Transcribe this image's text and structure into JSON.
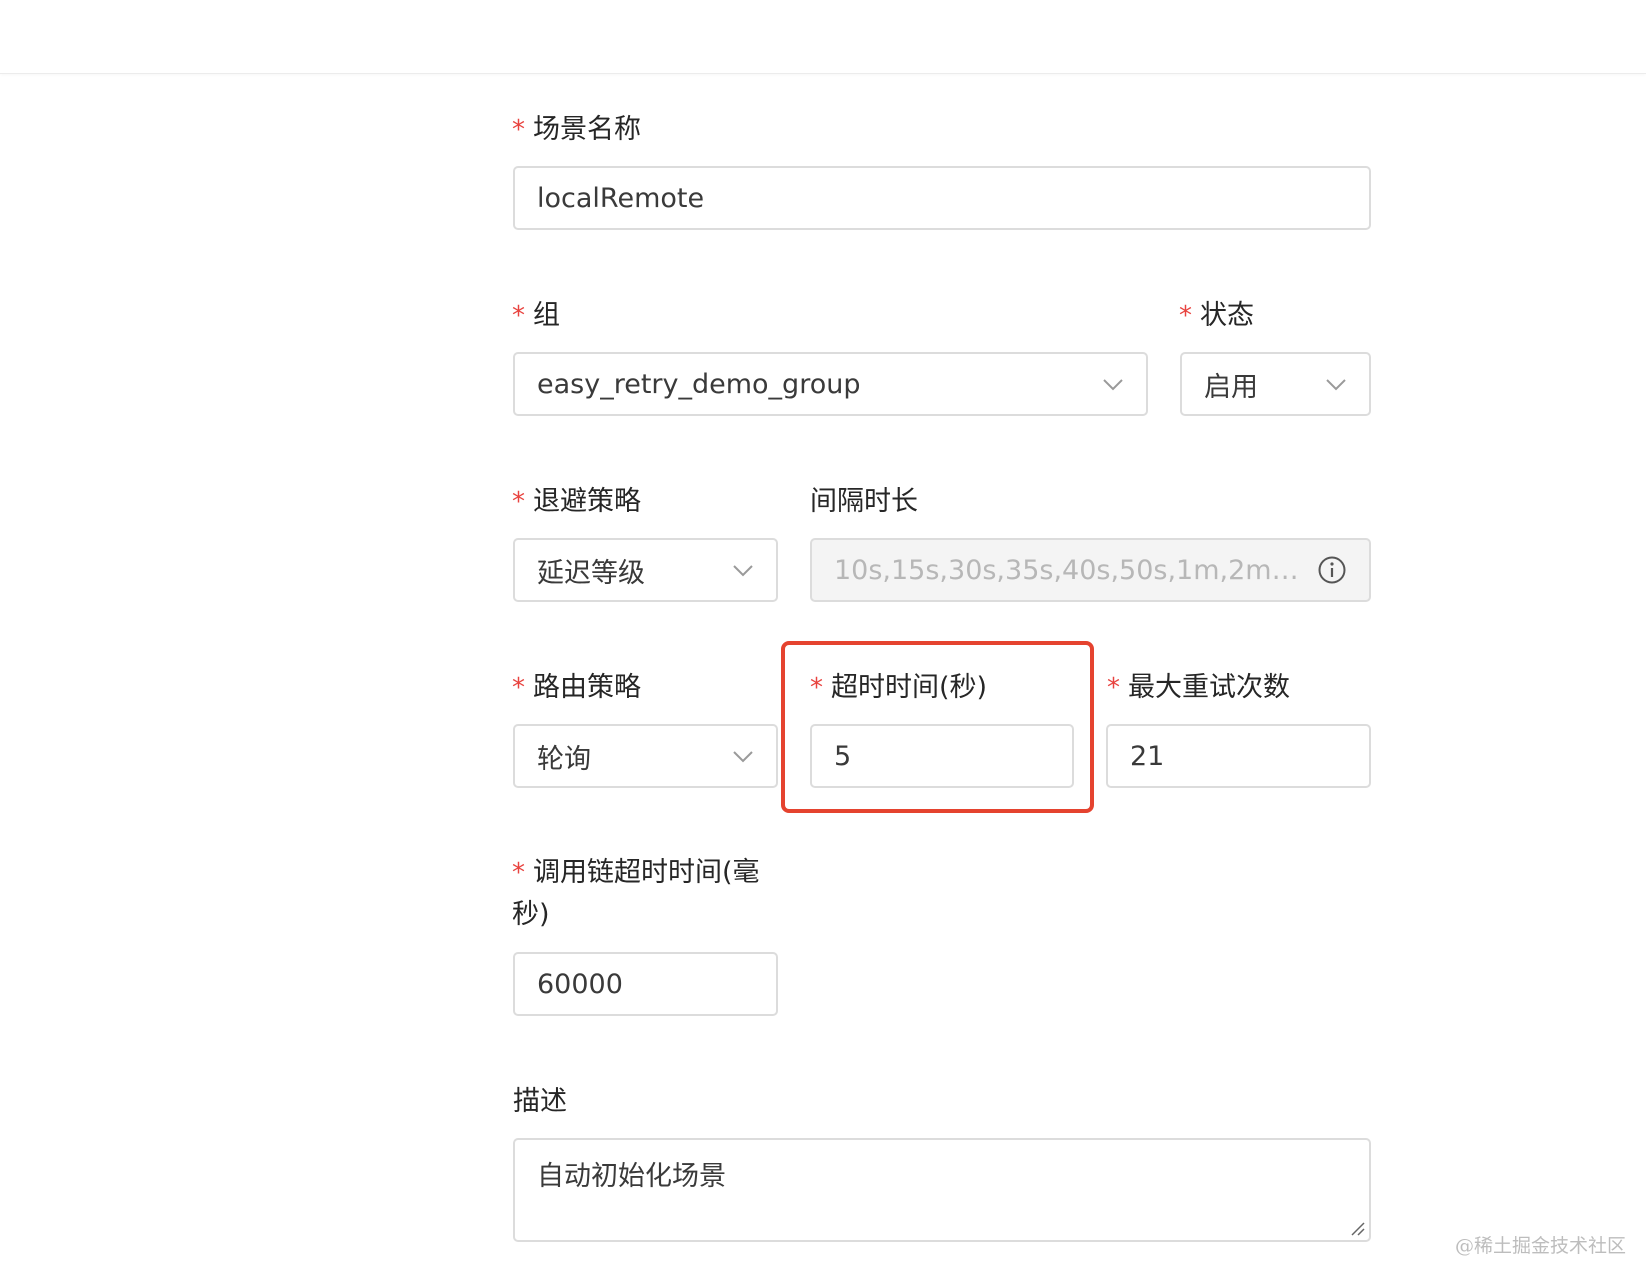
{
  "form": {
    "scene_name": {
      "label": "场景名称",
      "value": "localRemote"
    },
    "group": {
      "label": "组",
      "value": "easy_retry_demo_group"
    },
    "status": {
      "label": "状态",
      "value": "启用"
    },
    "backoff_strategy": {
      "label": "退避策略",
      "value": "延迟等级"
    },
    "interval": {
      "label": "间隔时长",
      "value": "10s,15s,30s,35s,40s,50s,1m,2m,..."
    },
    "route_strategy": {
      "label": "路由策略",
      "value": "轮询"
    },
    "timeout": {
      "label": "超时时间(秒)",
      "value": "5"
    },
    "max_retry": {
      "label": "最大重试次数",
      "value": "21"
    },
    "trace_timeout": {
      "label": "调用链超时时间(毫秒)",
      "value": "60000"
    },
    "description": {
      "label": "描述",
      "value": "自动初始化场景"
    }
  },
  "required_mark": "*",
  "watermark": "@稀土掘金技术社区",
  "colors": {
    "required": "#e8433f",
    "highlight": "#e5432f",
    "border": "#dcdcdc"
  },
  "icons": {
    "select_arrow": "chevron-down-icon",
    "info": "info-circle-icon",
    "resize": "resize-handle-icon"
  }
}
